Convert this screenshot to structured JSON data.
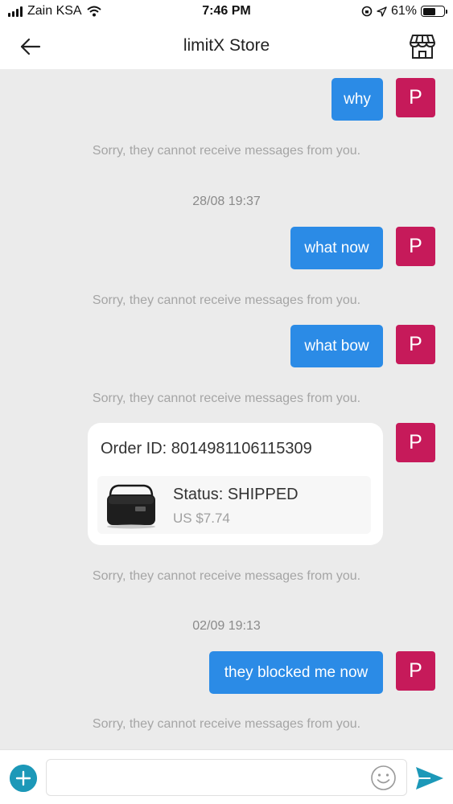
{
  "status_bar": {
    "carrier": "Zain KSA",
    "time": "7:46 PM",
    "battery": "61%",
    "battery_level": 0.61,
    "icons": [
      "signal-icon",
      "wifi-icon",
      "orientation-lock-icon",
      "location-arrow-icon",
      "battery-icon"
    ]
  },
  "header": {
    "title": "limitX Store",
    "back_icon": "arrow-left-icon",
    "store_icon": "storefront-icon"
  },
  "messages": [
    {
      "type": "outgoing",
      "text": "why",
      "avatar": "P"
    },
    {
      "type": "notice",
      "text": "Sorry, they cannot receive messages from you."
    },
    {
      "type": "timestamp",
      "text": "28/08 19:37"
    },
    {
      "type": "outgoing",
      "text": "what now",
      "avatar": "P"
    },
    {
      "type": "notice",
      "text": "Sorry, they cannot receive messages from you."
    },
    {
      "type": "outgoing",
      "text": "what bow",
      "avatar": "P"
    },
    {
      "type": "notice",
      "text": "Sorry, they cannot receive messages from you."
    },
    {
      "type": "order",
      "avatar": "P",
      "order_id_label": "Order ID: 8014981106115309",
      "status": "Status:  SHIPPED",
      "price": "US $7.74"
    },
    {
      "type": "notice",
      "text": "Sorry, they cannot receive messages from you."
    },
    {
      "type": "timestamp",
      "text": "02/09 19:13"
    },
    {
      "type": "outgoing",
      "text": "they blocked me now",
      "avatar": "P"
    },
    {
      "type": "notice",
      "text": "Sorry, they cannot receive messages from you."
    }
  ],
  "input_bar": {
    "value": "",
    "plus_icon": "plus-circle-icon",
    "emoji_icon": "smiley-icon",
    "send_icon": "send-icon"
  },
  "colors": {
    "bubble": "#2b8be6",
    "avatar": "#c61a5a",
    "accent": "#1c98b8",
    "background": "#ebebeb"
  }
}
